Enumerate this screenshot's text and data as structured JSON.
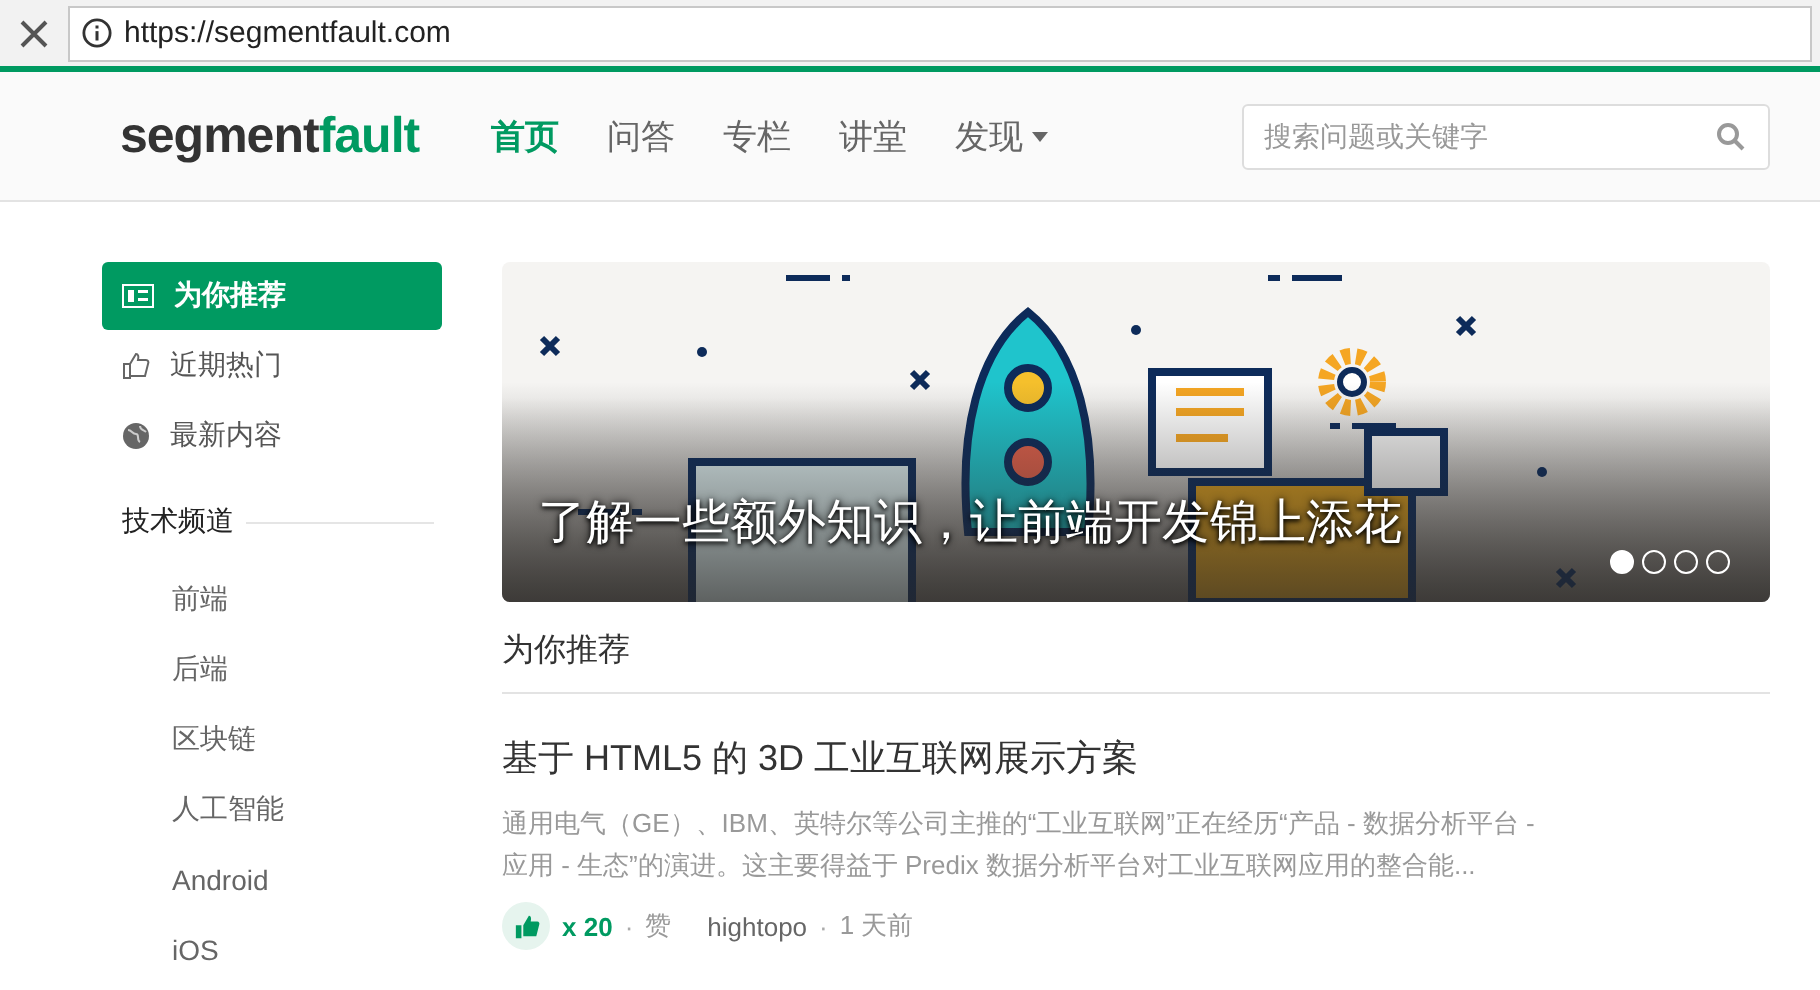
{
  "browser": {
    "url": "https://segmentfault.com"
  },
  "header": {
    "logo": {
      "dark": "segment",
      "green": "fault"
    },
    "nav": [
      {
        "label": "首页",
        "selected": true,
        "kind": "link"
      },
      {
        "label": "问答",
        "selected": false,
        "kind": "link"
      },
      {
        "label": "专栏",
        "selected": false,
        "kind": "link"
      },
      {
        "label": "讲堂",
        "selected": false,
        "kind": "link"
      },
      {
        "label": "发现",
        "selected": false,
        "kind": "dropdown"
      }
    ],
    "search": {
      "placeholder": "搜索问题或关键字"
    }
  },
  "sidebar": {
    "items": [
      {
        "label": "为你推荐",
        "kind": "recommend",
        "selected": true
      },
      {
        "label": "近期热门",
        "kind": "hot",
        "selected": false
      },
      {
        "label": "最新内容",
        "kind": "latest",
        "selected": false
      }
    ],
    "channels_title": "技术频道",
    "channels": [
      "前端",
      "后端",
      "区块链",
      "人工智能",
      "Android",
      "iOS"
    ]
  },
  "banner": {
    "caption": "了解一些额外知识，让前端开发锦上添花",
    "dots": [
      {
        "selected": true
      },
      {
        "selected": false
      },
      {
        "selected": false
      },
      {
        "selected": false
      }
    ]
  },
  "feed": {
    "title": "为你推荐",
    "articles": [
      {
        "title": "基于 HTML5 的 3D 工业互联网展示方案",
        "excerpt": "通用电气（GE）、IBM、英特尔等公司主推的“工业互联网”正在经历“产品 - 数据分析平台 - 应用 - 生态”的演进。这主要得益于 Predix 数据分析平台对工业互联网应用的整合能...",
        "likes": "x 20",
        "separator_1": "·",
        "like_label": "赞",
        "author": "hightopo",
        "separator_2": "·",
        "time": "1 天前"
      }
    ]
  }
}
